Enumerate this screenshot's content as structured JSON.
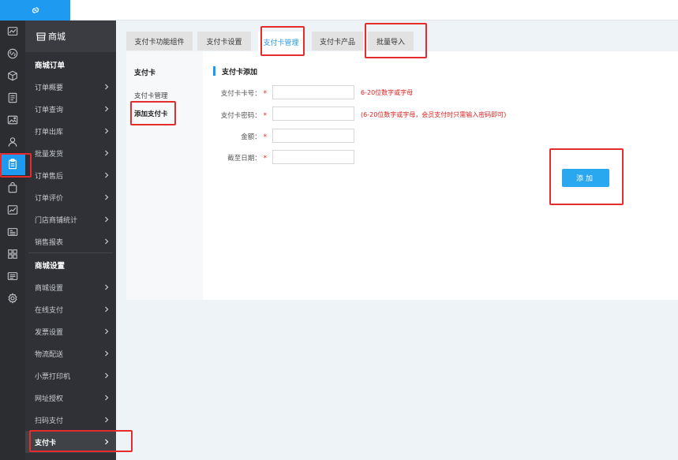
{
  "sidebar": {
    "title": "商城",
    "groups": {
      "orders": "商城订单",
      "settings": "商城设置"
    },
    "items": [
      {
        "label": "订单概要"
      },
      {
        "label": "订单查询"
      },
      {
        "label": "打单出库"
      },
      {
        "label": "批量发货"
      },
      {
        "label": "订单售后"
      },
      {
        "label": "订单评价"
      },
      {
        "label": "门店商铺统计"
      },
      {
        "label": "销售报表"
      },
      {
        "label": "商城设置"
      },
      {
        "label": "在线支付"
      },
      {
        "label": "发票设置"
      },
      {
        "label": "物流配送"
      },
      {
        "label": "小票打印机"
      },
      {
        "label": "网址授权"
      },
      {
        "label": "扫码支付"
      },
      {
        "label": "支付卡",
        "active": true
      }
    ]
  },
  "tabs": [
    {
      "label": "支付卡功能组件"
    },
    {
      "label": "支付卡设置"
    },
    {
      "label": "支付卡管理",
      "active": true
    },
    {
      "label": "支付卡产品"
    },
    {
      "label": "批量导入"
    }
  ],
  "subnav": {
    "title": "支付卡",
    "items": [
      {
        "label": "支付卡管理"
      },
      {
        "label": "添加支付卡",
        "active": true
      }
    ]
  },
  "form": {
    "title": "支付卡添加",
    "fields": [
      {
        "label": "支付卡卡号：",
        "required": "*",
        "value": "",
        "hint": "6-20位数字或字母"
      },
      {
        "label": "支付卡密码：",
        "required": "*",
        "value": "",
        "hint": "(6-20位数字或字母，会员支付时只需输入密码即可)"
      },
      {
        "label": "金额：",
        "required": "*",
        "value": "",
        "hint": ""
      },
      {
        "label": "截至日期：",
        "required": "*",
        "value": "",
        "hint": ""
      }
    ],
    "submit_label": "添加"
  },
  "colors": {
    "accent": "#1e9bf0",
    "button": "#2aa8ef",
    "sidebar_bg": "#2f3136",
    "required": "#e02020",
    "annotation": "#e52c2c"
  },
  "icons": {
    "logo": "link-logo-icon",
    "rail": [
      "chart-icon",
      "link-icon",
      "cube-icon",
      "document-icon",
      "image-icon",
      "user-icon",
      "clipboard-icon",
      "bag-icon",
      "trend-icon",
      "id-card-icon",
      "grid-icon",
      "card-icon",
      "gear-icon"
    ]
  }
}
